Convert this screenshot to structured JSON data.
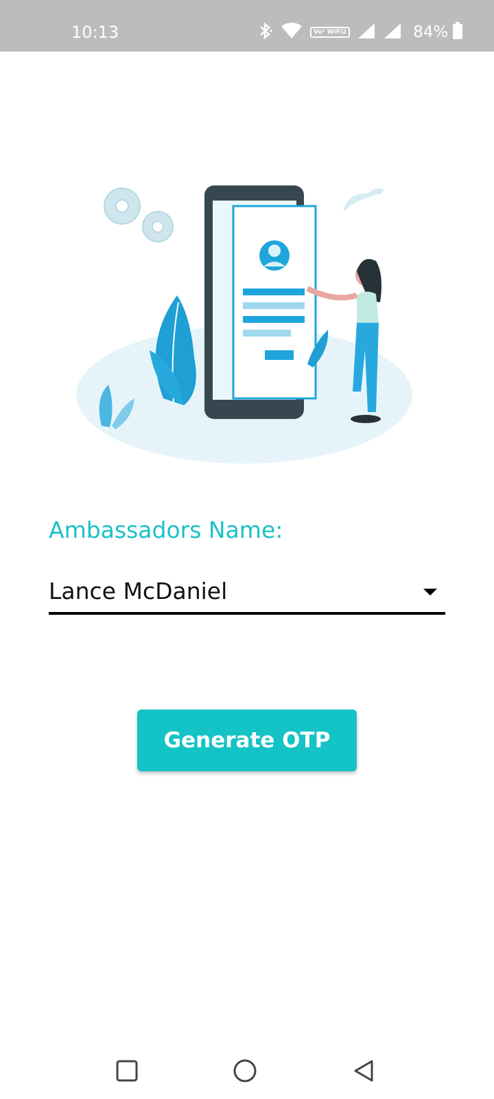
{
  "status_bar": {
    "time": "10:13",
    "vowifi": "Vo¹ WiFi2",
    "battery_percent": "84%",
    "icons": [
      "bluetooth-icon",
      "wifi-icon",
      "vowifi-icon",
      "signal-icon",
      "signal-icon",
      "battery-icon"
    ]
  },
  "form": {
    "label": "Ambassadors Name:",
    "selected_name": "Lance McDaniel"
  },
  "actions": {
    "generate_otp_label": "Generate OTP"
  },
  "colors": {
    "accent": "#14c3c6",
    "label": "#1ac1c6",
    "status_bar": "#bdbbbe"
  },
  "nav": {
    "icons": [
      "recents-square-icon",
      "home-circle-icon",
      "back-triangle-icon"
    ]
  }
}
